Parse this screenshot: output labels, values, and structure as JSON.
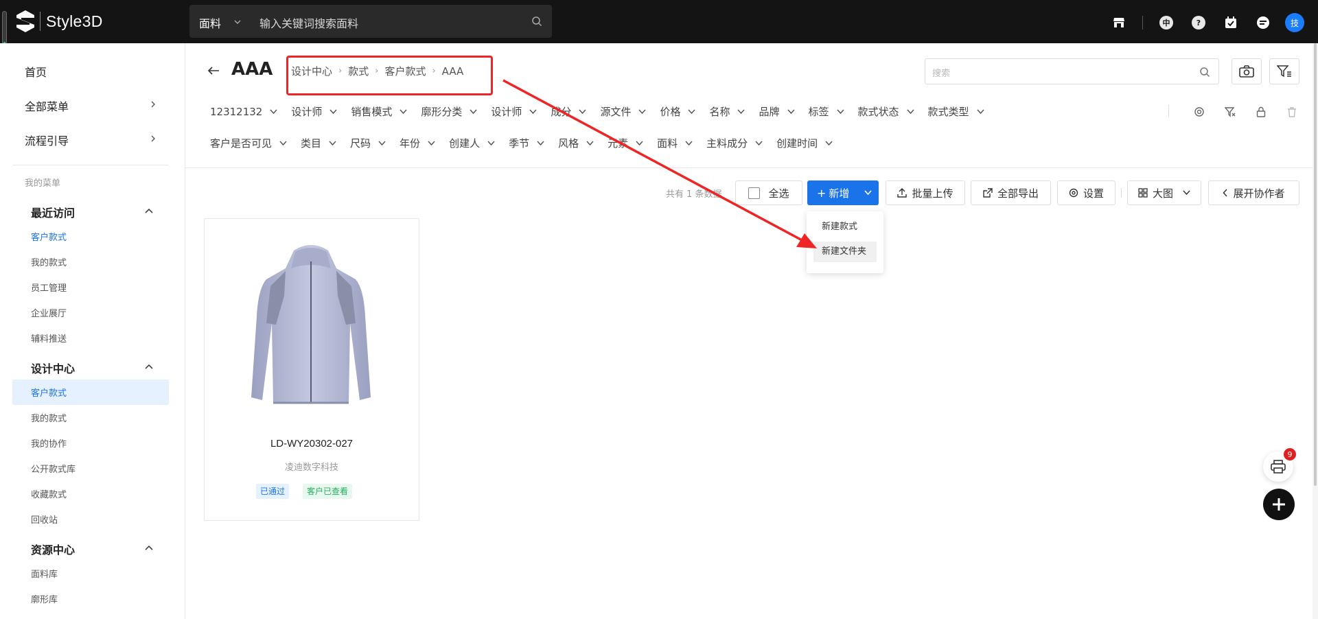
{
  "topbar": {
    "brand": "Style3D",
    "search_category": "面料",
    "search_placeholder": "输入关键词搜索面料",
    "icons": [
      "store-icon",
      "language-icon",
      "help-icon",
      "calendar-check-icon",
      "message-icon"
    ],
    "language_label": "中",
    "help_label": "?",
    "avatar_label": "技"
  },
  "sidebar": {
    "main_items": [
      {
        "label": "首页"
      },
      {
        "label": "全部菜单"
      },
      {
        "label": "流程引导"
      }
    ],
    "caption": "我的菜单",
    "sections": [
      {
        "title": "最近访问",
        "items": [
          "客户款式",
          "我的款式",
          "员工管理",
          "企业展厅",
          "辅料推送"
        ]
      },
      {
        "title": "设计中心",
        "items": [
          "客户款式",
          "我的款式",
          "我的协作",
          "公开款式库",
          "收藏款式",
          "回收站"
        ]
      },
      {
        "title": "资源中心",
        "items": [
          "面料库",
          "廓形库"
        ]
      }
    ]
  },
  "header": {
    "title": "AAA",
    "breadcrumb": [
      "设计中心",
      "款式",
      "客户款式",
      "AAA"
    ],
    "search_placeholder": "搜索"
  },
  "filters": {
    "row1": [
      "12312132",
      "设计师",
      "销售模式",
      "廓形分类",
      "设计师",
      "成分",
      "源文件",
      "价格",
      "名称",
      "品牌",
      "标签",
      "款式状态",
      "款式类型"
    ],
    "row2": [
      "客户是否可见",
      "类目",
      "尺码",
      "年份",
      "创建人",
      "季节",
      "风格",
      "元素",
      "面料",
      "主料成分",
      "创建时间"
    ]
  },
  "toolbar": {
    "count": "共有 1 条数据",
    "select_all": "全选",
    "add": "新增",
    "batch_upload": "批量上传",
    "export_all": "全部导出",
    "settings": "设置",
    "view": "大图",
    "collaborators": "展开协作者"
  },
  "dropdown": {
    "items": [
      "新建款式",
      "新建文件夹"
    ]
  },
  "card": {
    "code": "LD-WY20302-027",
    "company": "凌迪数字科技",
    "tags": [
      "已通过",
      "客户已查看"
    ]
  },
  "fab": {
    "badge": "9"
  },
  "colors": {
    "accent": "#1a73e8",
    "annotation": "#ef2525",
    "topbar": "#141414"
  }
}
